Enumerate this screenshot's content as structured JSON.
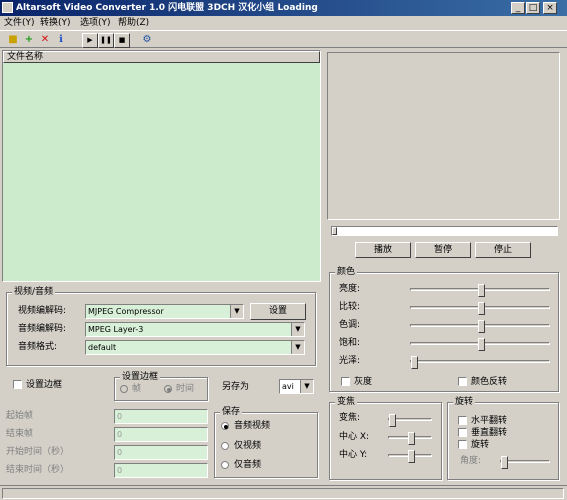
{
  "window": {
    "title": "Altarsoft Video Converter 1.0 闪电联盟 3DCH 汉化小组 Loading"
  },
  "menu": [
    "文件(Y)",
    "转换(Y)",
    "选项(Y)",
    "帮助(Z)"
  ],
  "file_list": {
    "column": "文件名称"
  },
  "playback": {
    "play": "播放",
    "pause": "暂停",
    "stop": "停止"
  },
  "av": {
    "group": "视频/音频",
    "video_codec_label": "视频编解码:",
    "video_codec": "MJPEG Compressor",
    "settings": "设置",
    "audio_codec_label": "音频编解码:",
    "audio_codec": "MPEG Layer-3",
    "audio_format_label": "音频格式:",
    "audio_format": "default"
  },
  "border": {
    "checkbox": "设置边框",
    "group": "设置边框",
    "frame": "帧",
    "time": "时间",
    "time_selected": true,
    "enabled": false
  },
  "save_as": {
    "label": "另存为",
    "format": "avi"
  },
  "range": {
    "start_frame": "起始帧",
    "end_frame": "结束帧",
    "start_time": "开始时间（秒）",
    "end_time": "结束时间（秒）",
    "start_frame_val": "0",
    "end_frame_val": "0",
    "start_time_val": "0",
    "end_time_val": "0"
  },
  "save": {
    "group": "保存",
    "options": [
      "音频视频",
      "仅视频",
      "仅音频"
    ],
    "selected": 0
  },
  "color": {
    "group": "颜色",
    "sliders": [
      {
        "label": "亮度:",
        "value": 0.5
      },
      {
        "label": "比较:",
        "value": 0.5
      },
      {
        "label": "色调:",
        "value": 0.5
      },
      {
        "label": "饱和:",
        "value": 0.5
      },
      {
        "label": "光泽:",
        "value": 0.0
      }
    ],
    "grayscale": "灰度",
    "invert": "颜色反转"
  },
  "zoom": {
    "group": "变焦",
    "zoom_label": "变焦:",
    "zoom_value": 0.0,
    "cx_label": "中心 X:",
    "cx_value": 0.5,
    "cy_label": "中心 Y:",
    "cy_value": 0.5
  },
  "rotate": {
    "group": "旋转",
    "hflip": "水平翻转",
    "vflip": "垂直翻转",
    "rotate": "旋转",
    "angle_label": "角度:",
    "angle_value": 0.0
  },
  "icons": [
    "open-folder-icon",
    "add-icon",
    "delete-icon",
    "info-icon",
    "play-icon",
    "pause-icon",
    "stop-icon",
    "settings-icon"
  ],
  "colors": {
    "titlebar": "#0a246a",
    "field_bg": "#d8efd8",
    "face": "#d4d0c8"
  }
}
